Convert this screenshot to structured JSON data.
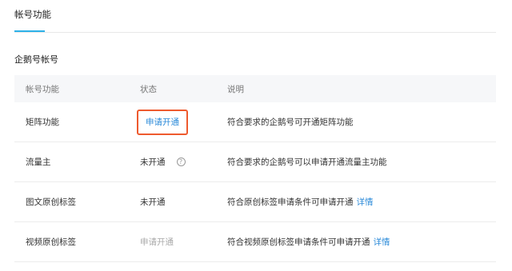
{
  "tabs": [
    {
      "label": "帐号功能",
      "active": true
    }
  ],
  "section": {
    "title": "企鹅号帐号"
  },
  "table": {
    "headers": [
      "帐号功能",
      "状态",
      "说明"
    ],
    "rows": [
      {
        "name": "矩阵功能",
        "status": "申请开通",
        "status_type": "link-highlighted",
        "desc": "符合要求的企鹅号可开通矩阵功能"
      },
      {
        "name": "流量主",
        "status": "未开通",
        "status_type": "text-with-help",
        "help_icon": "question-circle-icon",
        "desc": "符合要求的企鹅号可以申请开通流量主功能"
      },
      {
        "name": "图文原创标签",
        "status": "未开通",
        "status_type": "text",
        "desc": "符合原创标签申请条件可申请开通",
        "detail": "详情"
      },
      {
        "name": "视频原创标签",
        "status": "申请开通",
        "status_type": "disabled-link",
        "desc": "符合视频原创标签申请条件可申请开通",
        "detail": "详情"
      }
    ]
  },
  "colors": {
    "accent": "#2db1e8",
    "link": "#2d8bd9",
    "highlight_border": "#ee5a2e",
    "disabled": "#aaaaaa",
    "header_bg": "#f6f7f9"
  }
}
